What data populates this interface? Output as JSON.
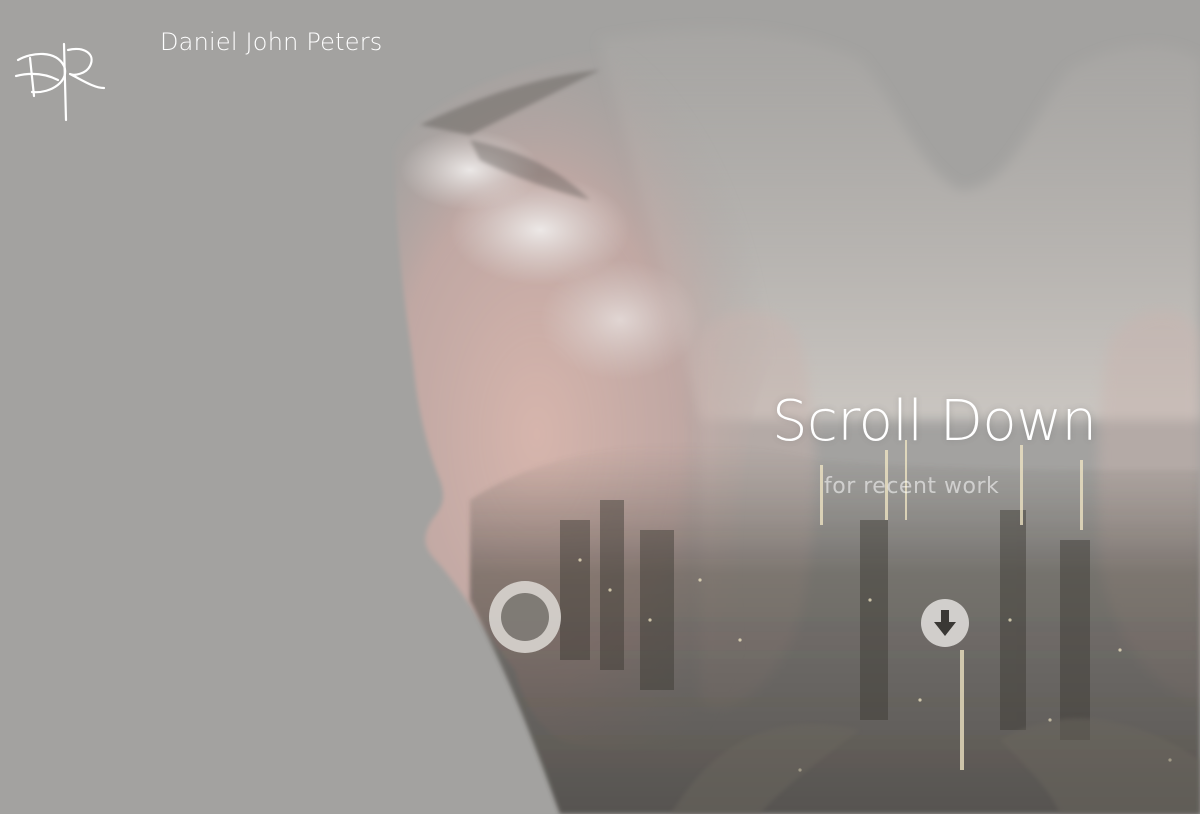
{
  "header": {
    "logo_monogram": "DPR",
    "site_title": "Daniel John Peters"
  },
  "hero": {
    "heading": "Scroll Down",
    "subheading": "for recent work",
    "scroll_button_icon": "arrow-down-circle-icon"
  },
  "colors": {
    "background": "#a3a2a0",
    "text": "#ffffff",
    "skin_tint": "#d8b3ab"
  }
}
